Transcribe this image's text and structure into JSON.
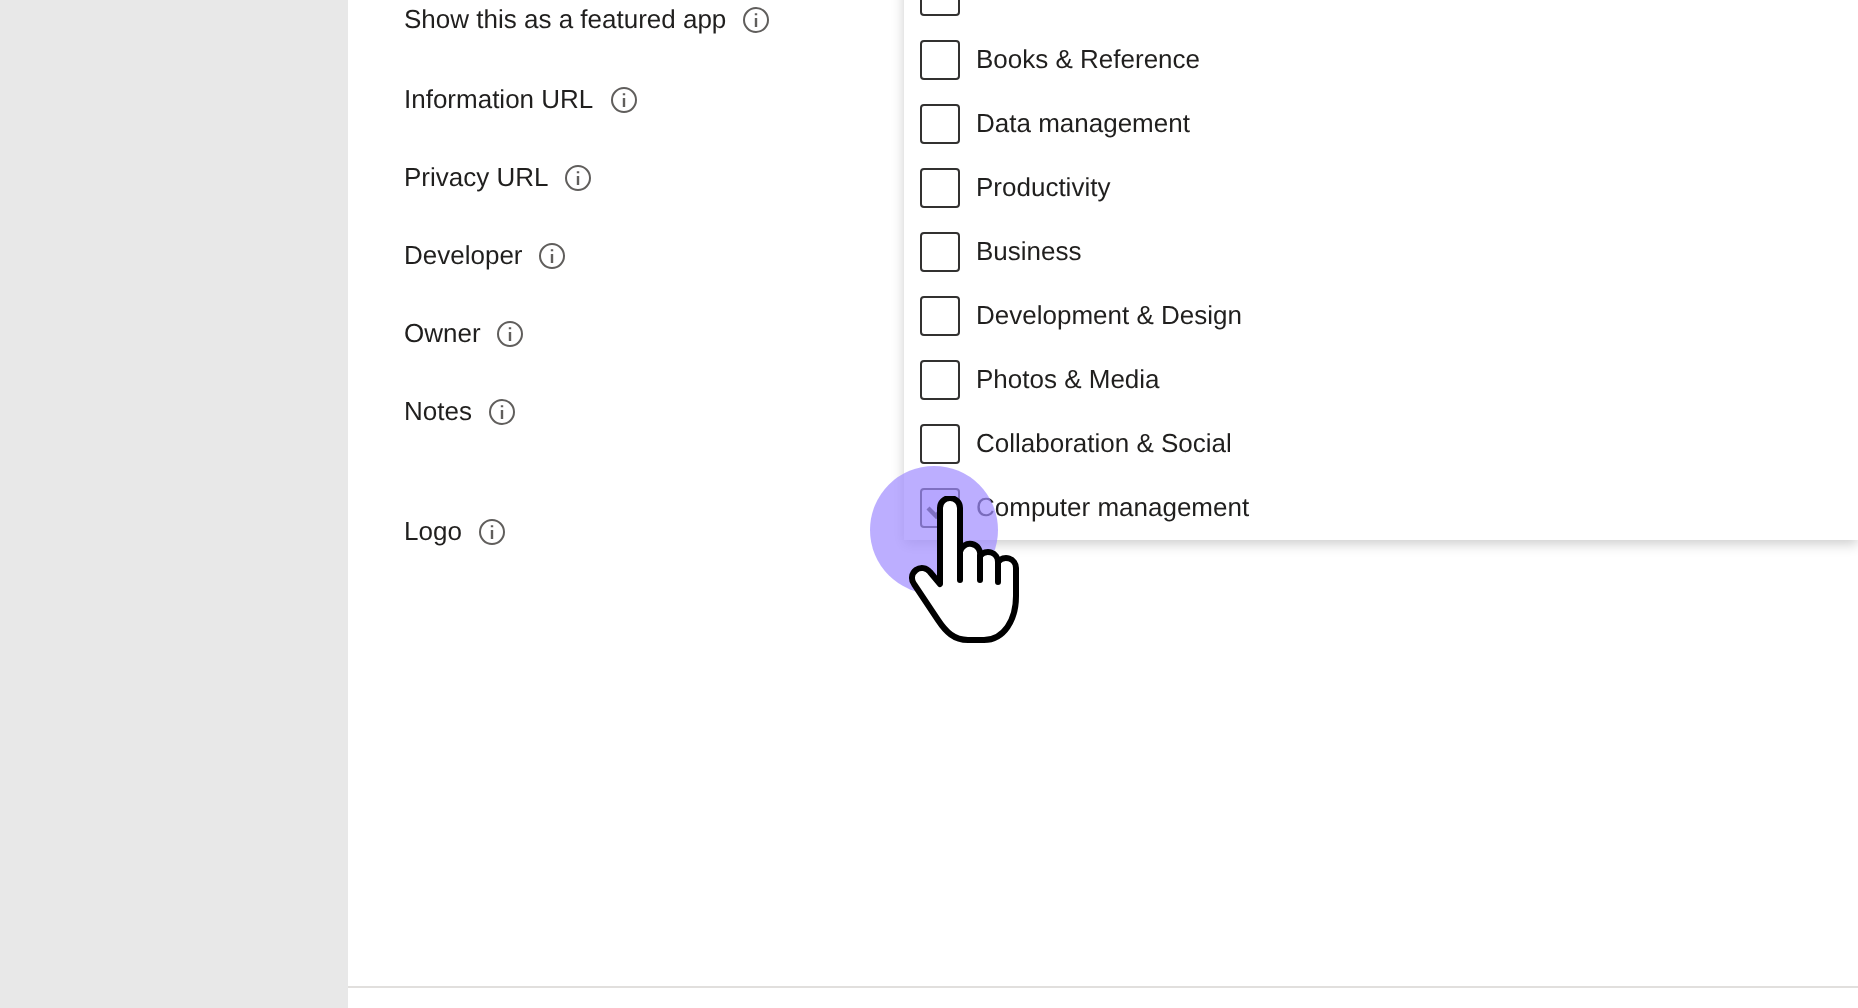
{
  "fields": [
    {
      "label": "Show this as a featured app"
    },
    {
      "label": "Information URL"
    },
    {
      "label": "Privacy URL"
    },
    {
      "label": "Developer"
    },
    {
      "label": "Owner"
    },
    {
      "label": "Notes"
    },
    {
      "label": "Logo"
    }
  ],
  "category_dropdown": {
    "options": [
      {
        "checked": false
      },
      {
        "label": "Books & Reference",
        "checked": false
      },
      {
        "label": "Data management",
        "checked": false
      },
      {
        "label": "Productivity",
        "checked": false
      },
      {
        "label": "Business",
        "checked": false
      },
      {
        "label": "Development & Design",
        "checked": false
      },
      {
        "label": "Photos & Media",
        "checked": false
      },
      {
        "label": "Collaboration & Social",
        "checked": false
      },
      {
        "label": "Computer management",
        "checked": true
      }
    ]
  }
}
